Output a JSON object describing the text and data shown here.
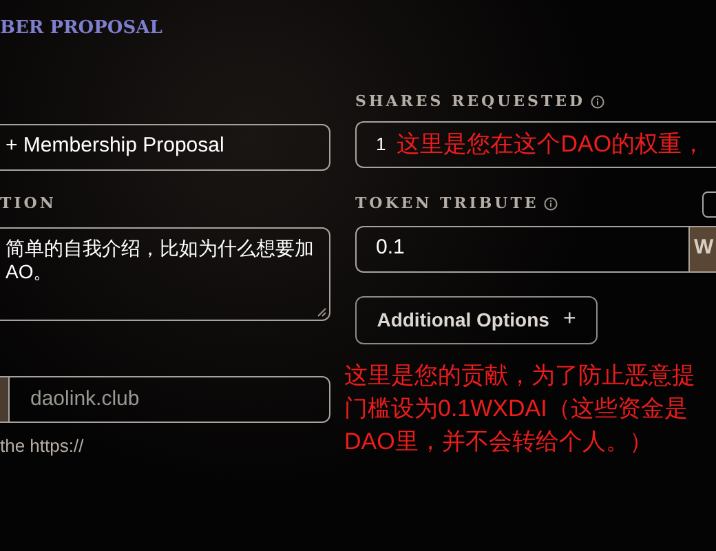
{
  "header": {
    "title": "BER PROPOSAL"
  },
  "left": {
    "title_field": {
      "value": "+ Membership Proposal"
    },
    "description": {
      "label": "TION",
      "value_lines": [
        "简单的自我介绍，比如为什么想要加",
        "AO。"
      ]
    },
    "link": {
      "placeholder": "daolink.club",
      "hint": "the https://"
    }
  },
  "right": {
    "shares": {
      "label": "SHARES REQUESTED",
      "value": "1"
    },
    "tribute": {
      "label": "TOKEN TRIBUTE",
      "value": "0.1",
      "unit": "W"
    },
    "additional_options": {
      "label": "Additional Options",
      "icon": "+"
    }
  },
  "annotations": [
    {
      "kind": "inline",
      "lines": [
        "这里是您在这个DAO的权重，"
      ]
    },
    {
      "kind": "block",
      "lines": [
        "这里是您的贡献，为了防止恶意提",
        "门槛设为0.1WXDAI（这些资金是",
        "DAO里，并不会转给个人。）"
      ]
    }
  ]
}
